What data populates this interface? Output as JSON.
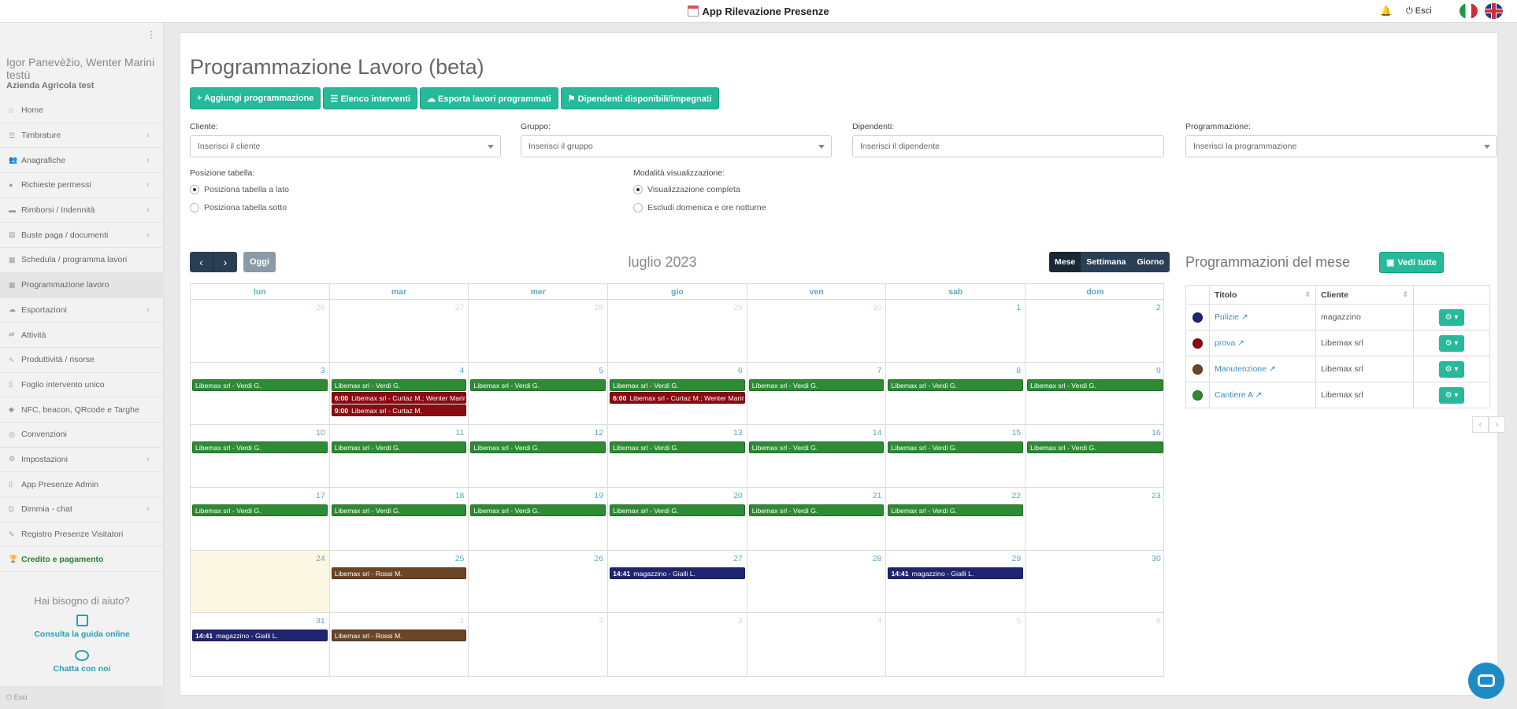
{
  "app_title": "App Rilevazione Presenze",
  "header": {
    "logout": "⏻ Esci"
  },
  "user": {
    "name": "Igor Panevèžio, Wenter Marini testù",
    "company": "Azienda Agricola test"
  },
  "nav": [
    {
      "label": "Home",
      "icon": "home-icon",
      "glyph": "⌂",
      "chevron": false
    },
    {
      "label": "Timbrature",
      "icon": "list-icon",
      "glyph": "☰",
      "chevron": true
    },
    {
      "label": "Anagrafiche",
      "icon": "users-icon",
      "glyph": "👥",
      "chevron": true
    },
    {
      "label": "Richieste permessi",
      "icon": "comment-icon",
      "glyph": "●",
      "chevron": true
    },
    {
      "label": "Rimborsi / Indennità",
      "icon": "folder-icon",
      "glyph": "▬",
      "chevron": true
    },
    {
      "label": "Buste paga / documenti",
      "icon": "document-icon",
      "glyph": "▤",
      "chevron": true
    },
    {
      "label": "Schedula / programma lavori",
      "icon": "table-icon",
      "glyph": "▦",
      "chevron": false
    },
    {
      "label": "Programmazione lavoro",
      "icon": "calendar-icon",
      "glyph": "▦",
      "chevron": false,
      "active": true
    },
    {
      "label": "Esportazioni",
      "icon": "cloud-icon",
      "glyph": "☁",
      "chevron": true
    },
    {
      "label": "Attività",
      "icon": "sliders-icon",
      "glyph": "⇌",
      "chevron": false
    },
    {
      "label": "Produttività / risorse",
      "icon": "chart-icon",
      "glyph": "∿",
      "chevron": false
    },
    {
      "label": "Foglio intervento unico",
      "icon": "file-icon",
      "glyph": "▯",
      "chevron": false
    },
    {
      "label": "NFC, beacon, QRcode e Targhe",
      "icon": "tag-icon",
      "glyph": "◆",
      "chevron": false
    },
    {
      "label": "Convenzioni",
      "icon": "handshake-icon",
      "glyph": "◎",
      "chevron": false
    },
    {
      "label": "Impostazioni",
      "icon": "gear-icon",
      "glyph": "⚙",
      "chevron": true
    },
    {
      "label": "App Presenze Admin",
      "icon": "mobile-icon",
      "glyph": "▯",
      "chevron": false
    },
    {
      "label": "Dimmia - chat",
      "icon": "dimmia-icon",
      "glyph": "D",
      "chevron": true
    },
    {
      "label": "Registro Presenze Visitatori",
      "icon": "pen-icon",
      "glyph": "✎",
      "chevron": false
    },
    {
      "label": "Credito e pagamento",
      "icon": "trophy-icon",
      "glyph": "🏆",
      "chevron": false,
      "bold": true
    }
  ],
  "help": {
    "question": "Hai bisogno di aiuto?",
    "guide": "Consulta la guida online",
    "chat": "Chatta con noi"
  },
  "sidebar_logout": "⏻ Esci",
  "page": {
    "title": "Programmazione Lavoro (beta)",
    "buttons": [
      {
        "label": "+ Aggiungi programmazione",
        "name": "add-programming-button"
      },
      {
        "label": "☰ Elenco interventi",
        "name": "interventions-list-button"
      },
      {
        "label": "☁ Esporta lavori programmati",
        "name": "export-button"
      },
      {
        "label": "⚑ Dipendenti disponibili/impegnati",
        "name": "available-employees-button"
      }
    ],
    "filters": {
      "cliente_label": "Cliente:",
      "cliente_placeholder": "Inserisci il cliente",
      "gruppo_label": "Gruppo:",
      "gruppo_placeholder": "Inserisci il gruppo",
      "dipendenti_label": "Dipendenti:",
      "dipendenti_placeholder": "Inserisci il dipendente",
      "programmazione_label": "Programmazione:",
      "programmazione_placeholder": "Inserisci la programmazione"
    },
    "posizione": {
      "label": "Posizione tabella:",
      "opt1": "Posiziona tabella a lato",
      "opt2": "Posiziona tabella sotto"
    },
    "modalita": {
      "label": "Modalità visualizzazione:",
      "opt1": "Visualizzazione completa",
      "opt2": "Escludi domenica e ore notturne"
    }
  },
  "calendar": {
    "title": "luglio 2023",
    "today_label": "Oggi",
    "views": [
      "Mese",
      "Settimana",
      "Giorno"
    ],
    "weekdays": [
      "lun",
      "mar",
      "mer",
      "gio",
      "ven",
      "sab",
      "dom"
    ],
    "colors": {
      "green": "#2e8b34",
      "red": "#8b0a12",
      "brown": "#6b4526",
      "navy": "#1f2570"
    },
    "weeks": [
      [
        {
          "d": "26",
          "other": true,
          "events": []
        },
        {
          "d": "27",
          "other": true,
          "events": []
        },
        {
          "d": "28",
          "other": true,
          "events": []
        },
        {
          "d": "29",
          "other": true,
          "events": []
        },
        {
          "d": "30",
          "other": true,
          "events": []
        },
        {
          "d": "1",
          "events": []
        },
        {
          "d": "2",
          "events": []
        }
      ],
      [
        {
          "d": "3",
          "events": [
            {
              "time": "",
              "text": "Libemax srl - Verdi G.",
              "color": "green"
            }
          ]
        },
        {
          "d": "4",
          "events": [
            {
              "time": "",
              "text": "Libemax srl - Verdi G.",
              "color": "green"
            },
            {
              "time": "6:00",
              "text": "Libemax srl - Curtaz M.; Wenter Marini",
              "color": "red"
            },
            {
              "time": "9:00",
              "text": "Libemax srl - Curtaz M.",
              "color": "red"
            }
          ]
        },
        {
          "d": "5",
          "events": [
            {
              "time": "",
              "text": "Libemax srl - Verdi G.",
              "color": "green"
            }
          ]
        },
        {
          "d": "6",
          "events": [
            {
              "time": "",
              "text": "Libemax srl - Verdi G.",
              "color": "green"
            },
            {
              "time": "6:00",
              "text": "Libemax srl - Curtaz M.; Wenter Marini",
              "color": "red"
            }
          ]
        },
        {
          "d": "7",
          "events": [
            {
              "time": "",
              "text": "Libemax srl - Verdi G.",
              "color": "green"
            }
          ]
        },
        {
          "d": "8",
          "events": [
            {
              "time": "",
              "text": "Libemax srl - Verdi G.",
              "color": "green"
            }
          ]
        },
        {
          "d": "9",
          "events": [
            {
              "time": "",
              "text": "Libemax srl - Verdi G.",
              "color": "green"
            }
          ]
        }
      ],
      [
        {
          "d": "10",
          "events": [
            {
              "time": "",
              "text": "Libemax srl - Verdi G.",
              "color": "green"
            }
          ]
        },
        {
          "d": "11",
          "events": [
            {
              "time": "",
              "text": "Libemax srl - Verdi G.",
              "color": "green"
            }
          ]
        },
        {
          "d": "12",
          "events": [
            {
              "time": "",
              "text": "Libemax srl - Verdi G.",
              "color": "green"
            }
          ]
        },
        {
          "d": "13",
          "events": [
            {
              "time": "",
              "text": "Libemax srl - Verdi G.",
              "color": "green"
            }
          ]
        },
        {
          "d": "14",
          "events": [
            {
              "time": "",
              "text": "Libemax srl - Verdi G.",
              "color": "green"
            }
          ]
        },
        {
          "d": "15",
          "events": [
            {
              "time": "",
              "text": "Libemax srl - Verdi G.",
              "color": "green"
            }
          ]
        },
        {
          "d": "16",
          "events": [
            {
              "time": "",
              "text": "Libemax srl - Verdi G.",
              "color": "green"
            }
          ]
        }
      ],
      [
        {
          "d": "17",
          "events": [
            {
              "time": "",
              "text": "Libemax srl - Verdi G.",
              "color": "green"
            }
          ]
        },
        {
          "d": "18",
          "events": [
            {
              "time": "",
              "text": "Libemax srl - Verdi G.",
              "color": "green"
            }
          ]
        },
        {
          "d": "19",
          "events": [
            {
              "time": "",
              "text": "Libemax srl - Verdi G.",
              "color": "green"
            }
          ]
        },
        {
          "d": "20",
          "events": [
            {
              "time": "",
              "text": "Libemax srl - Verdi G.",
              "color": "green"
            }
          ]
        },
        {
          "d": "21",
          "events": [
            {
              "time": "",
              "text": "Libemax srl - Verdi G.",
              "color": "green"
            }
          ]
        },
        {
          "d": "22",
          "events": [
            {
              "time": "",
              "text": "Libemax srl - Verdi G.",
              "color": "green"
            }
          ]
        },
        {
          "d": "23",
          "events": []
        }
      ],
      [
        {
          "d": "24",
          "today": true,
          "events": []
        },
        {
          "d": "25",
          "events": [
            {
              "time": "",
              "text": "Libemax srl - Rossi M.",
              "color": "brown"
            }
          ]
        },
        {
          "d": "26",
          "events": []
        },
        {
          "d": "27",
          "events": [
            {
              "time": "14:41",
              "text": "magazzino - Gialli L.",
              "color": "navy"
            }
          ]
        },
        {
          "d": "28",
          "events": []
        },
        {
          "d": "29",
          "events": [
            {
              "time": "14:41",
              "text": "magazzino - Gialli L.",
              "color": "navy"
            }
          ]
        },
        {
          "d": "30",
          "events": []
        }
      ],
      [
        {
          "d": "31",
          "events": [
            {
              "time": "14:41",
              "text": "magazzino - Gialli L.",
              "color": "navy"
            }
          ]
        },
        {
          "d": "1",
          "other": true,
          "events": [
            {
              "time": "",
              "text": "Libemax srl - Rossi M.",
              "color": "brown"
            }
          ]
        },
        {
          "d": "2",
          "other": true,
          "events": []
        },
        {
          "d": "3",
          "other": true,
          "events": []
        },
        {
          "d": "4",
          "other": true,
          "events": []
        },
        {
          "d": "5",
          "other": true,
          "events": []
        },
        {
          "d": "6",
          "other": true,
          "events": []
        }
      ]
    ]
  },
  "month_table": {
    "title": "Programmazioni del mese",
    "see_all": "Vedi tutte",
    "headers": [
      "Titolo",
      "Cliente"
    ],
    "rows": [
      {
        "color": "#1f2570",
        "title": "Pulizie",
        "client": "magazzino"
      },
      {
        "color": "#8b0a12",
        "title": "prova",
        "client": "Libemax srl"
      },
      {
        "color": "#6b4526",
        "title": "Manutenzione",
        "client": "Libemax srl"
      },
      {
        "color": "#2e8b34",
        "title": "Cantiere A",
        "client": "Libemax srl"
      }
    ]
  }
}
